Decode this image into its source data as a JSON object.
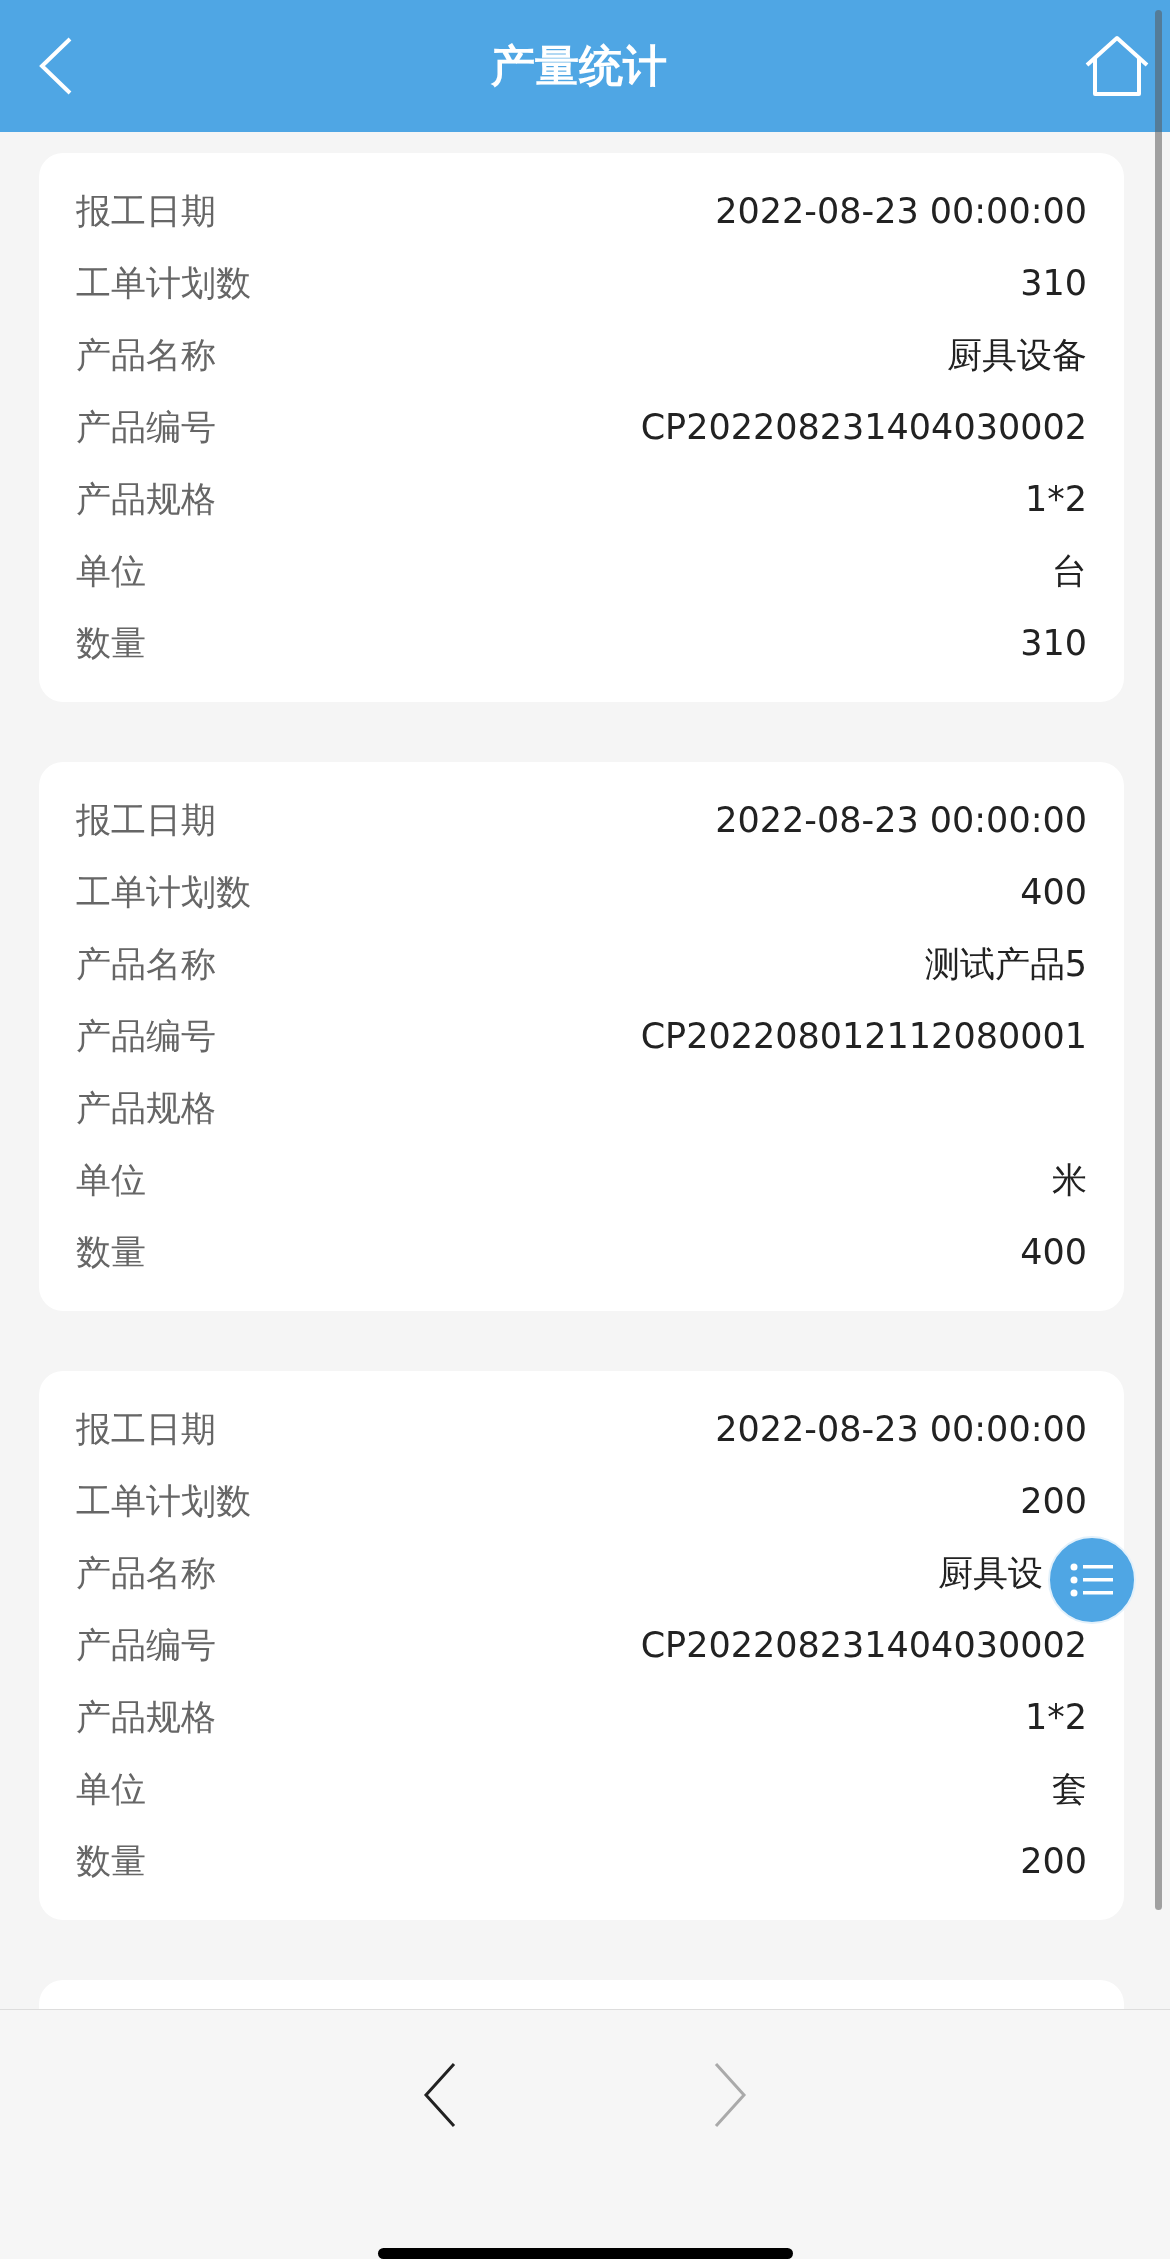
{
  "header": {
    "title": "产量统计"
  },
  "records": [
    {
      "fields": [
        {
          "label": "报工日期",
          "value": "2022-08-23 00:00:00"
        },
        {
          "label": "工单计划数",
          "value": "310"
        },
        {
          "label": "产品名称",
          "value": "厨具设备"
        },
        {
          "label": "产品编号",
          "value": "CP202208231404030002"
        },
        {
          "label": "产品规格",
          "value": "1*2"
        },
        {
          "label": "单位",
          "value": "台"
        },
        {
          "label": "数量",
          "value": "310"
        }
      ]
    },
    {
      "fields": [
        {
          "label": "报工日期",
          "value": "2022-08-23 00:00:00"
        },
        {
          "label": "工单计划数",
          "value": "400"
        },
        {
          "label": "产品名称",
          "value": "测试产品5"
        },
        {
          "label": "产品编号",
          "value": "CP202208012112080001"
        },
        {
          "label": "产品规格"
        },
        {
          "label": "单位",
          "value": "米"
        },
        {
          "label": "数量",
          "value": "400"
        }
      ]
    },
    {
      "fields": [
        {
          "label": "报工日期",
          "value": "2022-08-23 00:00:00"
        },
        {
          "label": "工单计划数",
          "value": "200"
        },
        {
          "label": "产品名称",
          "value": "厨具设",
          "covered": true
        },
        {
          "label": "产品编号",
          "value": "CP202208231404030002"
        },
        {
          "label": "产品规格",
          "value": "1*2"
        },
        {
          "label": "单位",
          "value": "套"
        },
        {
          "label": "数量",
          "value": "200"
        }
      ]
    },
    {
      "partially_visible": true
    }
  ],
  "pager": {
    "prev": {
      "disabled": false
    },
    "next": {
      "disabled": true
    }
  }
}
